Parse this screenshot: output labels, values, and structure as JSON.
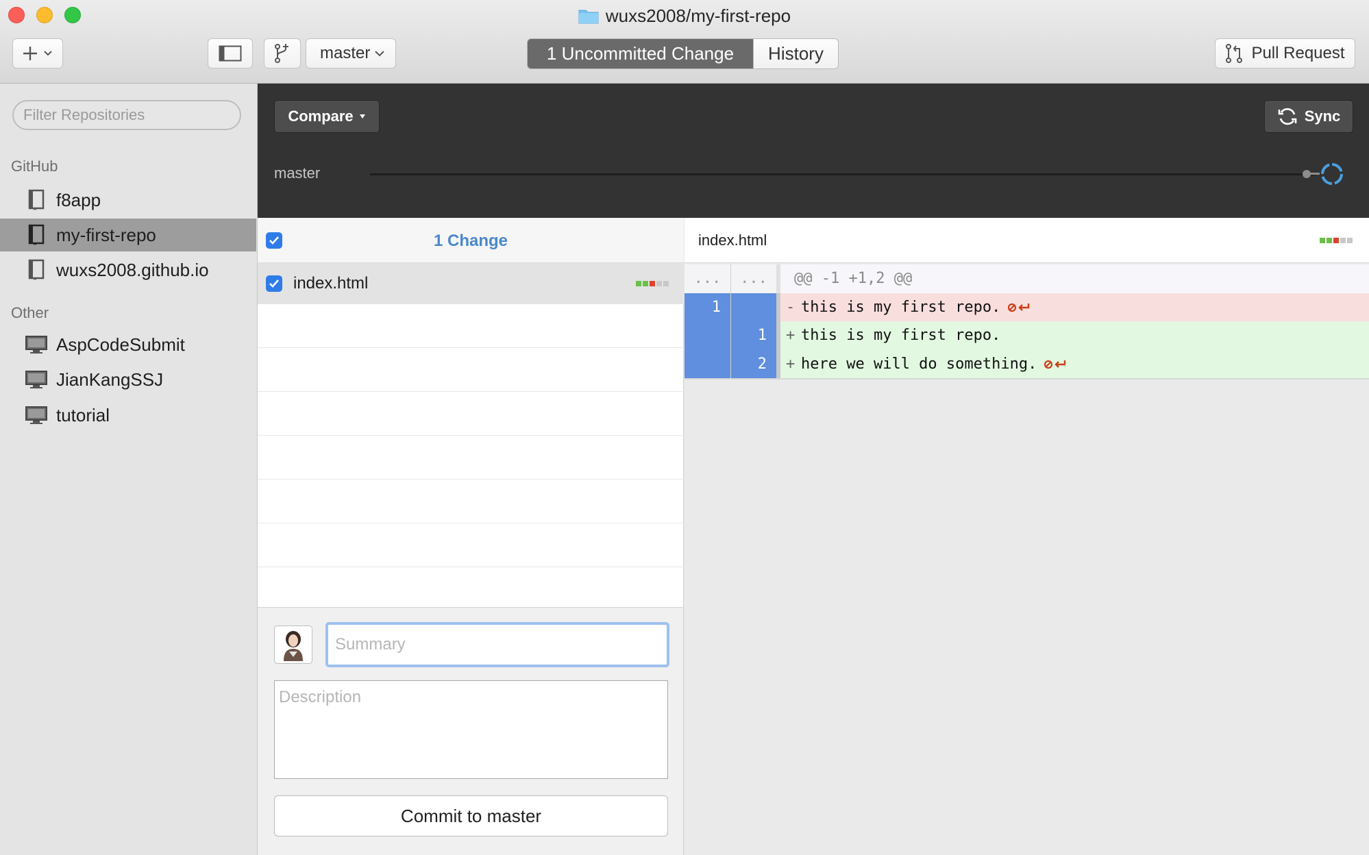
{
  "window": {
    "title": "wuxs2008/my-first-repo"
  },
  "toolbar": {
    "branch": "master",
    "tabs": [
      {
        "label": "1 Uncommitted Change",
        "active": true
      },
      {
        "label": "History",
        "active": false
      }
    ],
    "pull_request_label": "Pull Request"
  },
  "sidebar": {
    "filter_placeholder": "Filter Repositories",
    "sections": [
      {
        "heading": "GitHub",
        "items": [
          {
            "label": "f8app",
            "icon": "repo-book-icon",
            "active": false
          },
          {
            "label": "my-first-repo",
            "icon": "repo-book-icon",
            "active": true
          },
          {
            "label": "wuxs2008.github.io",
            "icon": "repo-book-icon",
            "active": false
          }
        ]
      },
      {
        "heading": "Other",
        "items": [
          {
            "label": "AspCodeSubmit",
            "icon": "computer-icon",
            "active": false
          },
          {
            "label": "JianKangSSJ",
            "icon": "computer-icon",
            "active": false
          },
          {
            "label": "tutorial",
            "icon": "computer-icon",
            "active": false
          }
        ]
      }
    ]
  },
  "compare_bar": {
    "compare_label": "Compare",
    "sync_label": "Sync",
    "branch_label": "master"
  },
  "changes": {
    "header": "1 Change",
    "all_checked": true,
    "files": [
      {
        "name": "index.html",
        "checked": true
      }
    ]
  },
  "commit": {
    "summary_placeholder": "Summary",
    "description_placeholder": "Description",
    "button_label": "Commit to master"
  },
  "diff": {
    "file_name": "index.html",
    "lines": [
      {
        "type": "hunk",
        "old": "...",
        "new": "...",
        "sign": "",
        "text": "@@ -1 +1,2 @@",
        "no_newline": false
      },
      {
        "type": "del",
        "old": "1",
        "new": "",
        "sign": "-",
        "text": "this is my first repo.",
        "no_newline": true
      },
      {
        "type": "add",
        "old": "",
        "new": "1",
        "sign": "+",
        "text": "this is my first repo.",
        "no_newline": false
      },
      {
        "type": "add",
        "old": "",
        "new": "2",
        "sign": "+",
        "text": "here we will do something.",
        "no_newline": true
      }
    ]
  },
  "colors": {
    "accent_blue": "#2f7ce8",
    "line_number_blue": "#5f8fde",
    "deleted_bg": "#f9dede",
    "added_bg": "#e2f8e1",
    "no_newline_red": "#c9411a",
    "diffstat_green": "#6cc04a",
    "diffstat_red": "#d9442b",
    "diffstat_gray": "#c8c8c8"
  }
}
